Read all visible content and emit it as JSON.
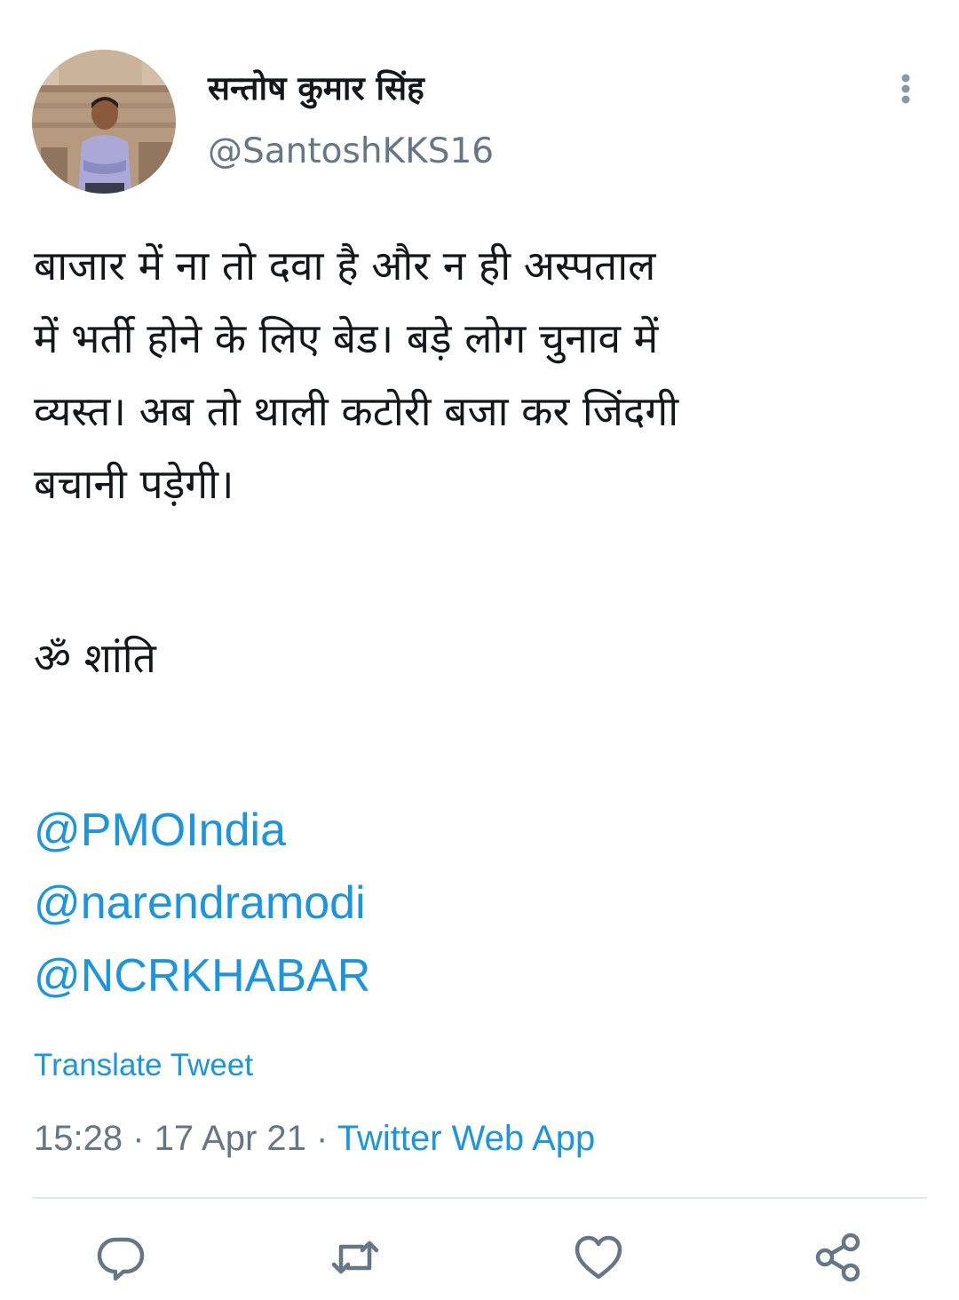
{
  "author": {
    "display_name": "सन्तोष कुमार सिंह",
    "handle": "@SantoshKKS16"
  },
  "tweet": {
    "lines": [
      "बाजार में ना तो दवा है और न ही अस्पताल",
      "में भर्ती होने के लिए बेड। बड़े लोग चुनाव में",
      "व्यस्त। अब तो थाली कटोरी बजा कर जिंदगी",
      "बचानी पड़ेगी।"
    ],
    "closing": "ॐ शांति",
    "mentions": [
      "@PMOIndia",
      "@narendramodi",
      "@NCRKHABAR"
    ]
  },
  "translate_label": "Translate Tweet",
  "meta": {
    "time": "15:28",
    "separator": " · ",
    "date": "17 Apr 21",
    "source": "Twitter Web App"
  },
  "actions": {
    "reply_icon": "reply-icon",
    "retweet_icon": "retweet-icon",
    "like_icon": "like-icon",
    "share_icon": "share-icon"
  },
  "colors": {
    "link": "#1b95e0",
    "secondary_text": "#657786",
    "icon": "#657786",
    "divider": "#e1e8ed"
  }
}
